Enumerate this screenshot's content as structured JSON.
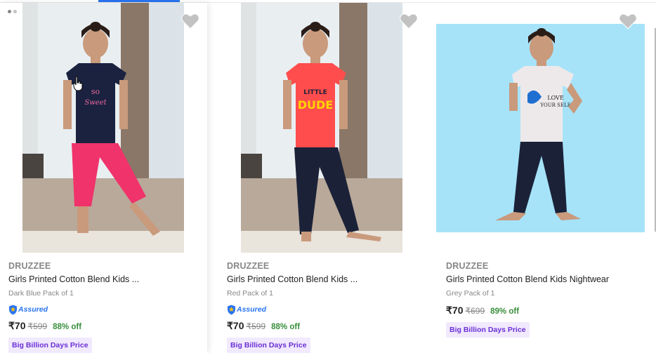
{
  "products": [
    {
      "brand": "DRUZZEE",
      "title": "Girls Printed Cotton Blend Kids ...",
      "variant": "Dark Blue Pack of 1",
      "assured_label": "Assured",
      "price": "₹70",
      "mrp": "₹599",
      "discount": "88% off",
      "tag": "Big Billion Days Price",
      "top_color": "#1a2240",
      "bottom_color": "#f0336b",
      "print_text": "SO Sweet"
    },
    {
      "brand": "DRUZZEE",
      "title": "Girls Printed Cotton Blend Kids ...",
      "variant": "Red Pack of 1",
      "assured_label": "Assured",
      "price": "₹70",
      "mrp": "₹599",
      "discount": "88% off",
      "tag": "Big Billion Days Price",
      "top_color": "#ff4d4d",
      "bottom_color": "#1b2238",
      "print_text": "LITTLE DUDE"
    },
    {
      "brand": "DRUZZEE",
      "title": "Girls Printed Cotton Blend Kids Nightwear",
      "variant": "Grey Pack of 1",
      "assured_label": "",
      "price": "₹70",
      "mrp": "₹699",
      "discount": "89% off",
      "tag": "Big Billion Days Price",
      "top_color": "#ede9ea",
      "bottom_color": "#1b2238",
      "print_text": "LOVE YOUR SELF"
    }
  ],
  "colors": {
    "accent": "#2874f0",
    "discount_green": "#388e3c",
    "tag_bg": "#f1e9fd",
    "tag_fg": "#6a2fd6",
    "wishlist_grey": "#c2c2c2"
  },
  "icons": {
    "wishlist": "heart-icon",
    "assured": "shield-icon",
    "cursor": "hand-pointer-icon"
  }
}
